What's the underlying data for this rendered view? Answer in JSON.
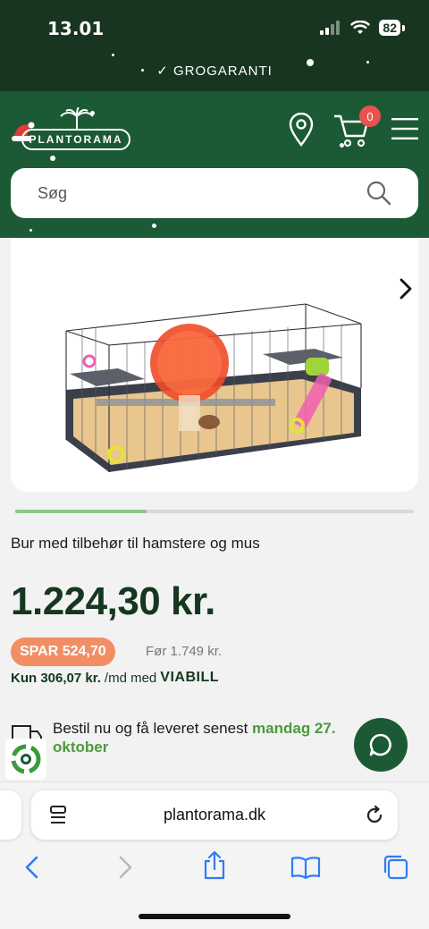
{
  "status_bar": {
    "time": "13.01",
    "battery": "82"
  },
  "guarantee": {
    "text": "✓ GROGARANTI"
  },
  "header": {
    "logo_text": "PLANTORAMA",
    "cart_count": "0",
    "search_placeholder": "Søg"
  },
  "gallery": {
    "progress": 0.33
  },
  "product": {
    "title": "Bur med tilbehør til hamstere og mus",
    "price": "1.224,30 kr.",
    "save_badge": "SPAR 524,70",
    "old_price": "Før 1.749 kr.",
    "installment_amount": "Kun 306,07 kr.",
    "installment_suffix": "/md med",
    "installment_provider": "VIABILL"
  },
  "delivery": {
    "text_before": "Bestil nu og få leveret senest ",
    "date": "mandag 27. oktober"
  },
  "browser": {
    "url": "plantorama.dk"
  },
  "colors": {
    "header_green": "#1b5a34",
    "dark_green": "#183520",
    "save_orange": "#f28e63",
    "cart_badge": "#e8534f",
    "accent_green": "#4d9a3b"
  }
}
